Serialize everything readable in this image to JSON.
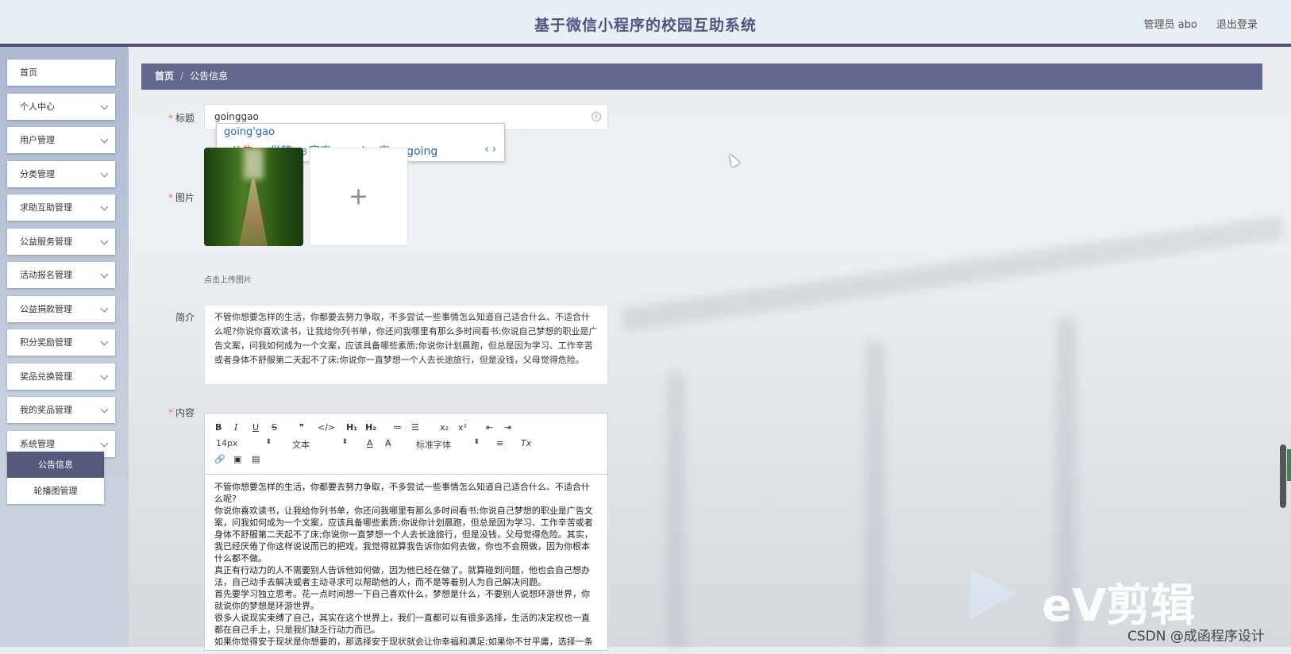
{
  "header": {
    "title": "基于微信小程序的校园互助系统",
    "admin_label": "管理员 abo",
    "logout_label": "退出登录"
  },
  "sidebar": {
    "items": [
      {
        "label": "首页",
        "has_chevron": false
      },
      {
        "label": "个人中心",
        "has_chevron": true
      },
      {
        "label": "用户管理",
        "has_chevron": true
      },
      {
        "label": "分类管理",
        "has_chevron": true
      },
      {
        "label": "求助互助管理",
        "has_chevron": true
      },
      {
        "label": "公益服务管理",
        "has_chevron": true
      },
      {
        "label": "活动报名管理",
        "has_chevron": true
      },
      {
        "label": "公益捐款管理",
        "has_chevron": true
      },
      {
        "label": "积分奖励管理",
        "has_chevron": true
      },
      {
        "label": "奖品兑换管理",
        "has_chevron": true
      },
      {
        "label": "我的奖品管理",
        "has_chevron": true
      },
      {
        "label": "系统管理",
        "has_chevron": true
      }
    ],
    "submenu": [
      {
        "label": "公告信息",
        "active": true
      },
      {
        "label": "轮播图管理",
        "active": false
      }
    ]
  },
  "breadcrumb": {
    "home": "首页",
    "separator": "/",
    "current": "公告信息"
  },
  "form": {
    "title": {
      "label": "标题",
      "required": true,
      "value": "goinggao"
    },
    "image": {
      "label": "图片",
      "required": true,
      "hint": "点击上传图片",
      "add_icon": "plus-icon"
    },
    "intro": {
      "label": "简介",
      "required": false,
      "value": "不管你想要怎样的生活，你都要去努力争取，不多尝试一些事情怎么知道自己适合什么、不适合什么呢?你说你喜欢读书，让我给你列书单，你还问我哪里有那么多时间看书;你说自己梦想的职业是广告文案，问我如何成为一个文案，应该具备哪些素质;你说你计划晨跑，但总是因为学习、工作辛苦或者身体不舒服第二天起不了床;你说你一直梦想一个人去长途旅行，但是没钱，父母觉得危险。"
    },
    "content": {
      "label": "内容",
      "required": true,
      "toolbar": {
        "bold": "B",
        "italic": "I",
        "underline": "U",
        "strike": "S",
        "quote": "❞",
        "code": "</>",
        "h1": "H₁",
        "h2": "H₂",
        "ol": "≔",
        "ul": "☰",
        "sub": "x₂",
        "sup": "x²",
        "outdent": "⇤",
        "indent": "⇥",
        "size": "14px",
        "format": "文本",
        "font_color": "A",
        "bg_color": "A",
        "font": "标准字体",
        "align": "≡",
        "clear": "Tx",
        "link": "🔗",
        "image": "▣",
        "video": "▤"
      },
      "paragraphs": [
        "不管你想要怎样的生活，你都要去努力争取，不多尝试一些事情怎么知道自己适合什么、不适合什么呢?",
        "你说你喜欢读书，让我给你列书单，你还问我哪里有那么多时间看书;你说自己梦想的职业是广告文案，问我如何成为一个文案，应该具备哪些素质;你说你计划晨跑，但总是因为学习、工作辛苦或者身体不舒服第二天起不了床;你说你一直梦想一个人去长途旅行，但是没钱，父母觉得危险。其实，我已经厌倦了你这样说说而已的把戏，我觉得就算我告诉你如何去做，你也不会照做，因为你根本什么都不做。",
        "真正有行动力的人不需要别人告诉他如何做，因为他已经在做了。就算碰到问题，他也会自己想办法，自己动手去解决或者主动寻求可以帮助他的人，而不是等着别人为自己解决问题。",
        "首先要学习独立思考。花一点时间想一下自己喜欢什么，梦想是什么，不要别人说想环游世界，你就说你的梦想是环游世界。",
        "很多人说现实束缚了自己，其实在这个世界上，我们一直都可以有很多选择，生活的决定权也一直都在自己手上，只是我们缺乏行动力而已。",
        "如果你觉得安于现状是你想要的，那选择安于现状就会让你幸福和满足;如果你不甘平庸，选择一条"
      ]
    }
  },
  "ime": {
    "composition": "going'gao",
    "candidates": [
      {
        "num": "1",
        "text": "公告"
      },
      {
        "num": "2",
        "text": "供稿"
      },
      {
        "num": "3",
        "text": "宣高"
      },
      {
        "num": "4",
        "text": "going高"
      },
      {
        "num": "5",
        "text": "going"
      }
    ],
    "nav": "‹ ›"
  },
  "watermark": {
    "logo_text": "eV剪辑",
    "csdn_text": "CSDN @成函程序设计"
  }
}
